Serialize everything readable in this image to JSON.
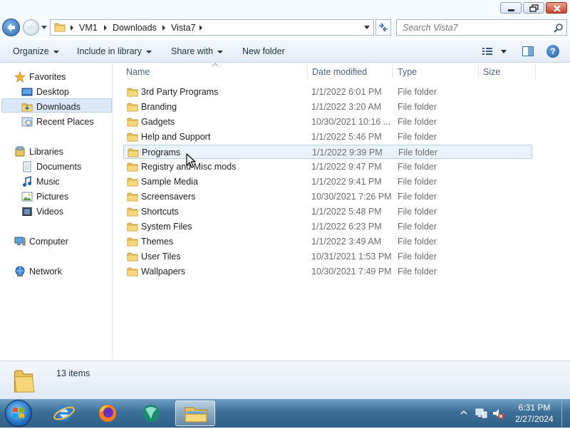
{
  "window": {
    "breadcrumb": [
      "VM1",
      "Downloads",
      "Vista7"
    ],
    "search_placeholder": "Search Vista7"
  },
  "toolbar": {
    "organize": "Organize",
    "include_in_library": "Include in library",
    "share_with": "Share with",
    "new_folder": "New folder"
  },
  "nav": {
    "favorites": "Favorites",
    "desktop": "Desktop",
    "downloads": "Downloads",
    "recent_places": "Recent Places",
    "libraries": "Libraries",
    "documents": "Documents",
    "music": "Music",
    "pictures": "Pictures",
    "videos": "Videos",
    "computer": "Computer",
    "network": "Network"
  },
  "columns": {
    "name": "Name",
    "date_modified": "Date modified",
    "type": "Type",
    "size": "Size"
  },
  "files": [
    {
      "name": "3rd Party Programs",
      "date": "1/1/2022 6:01 PM",
      "type": "File folder"
    },
    {
      "name": "Branding",
      "date": "1/1/2022 3:20 AM",
      "type": "File folder"
    },
    {
      "name": "Gadgets",
      "date": "10/30/2021 10:16 ...",
      "type": "File folder"
    },
    {
      "name": "Help and Support",
      "date": "1/1/2022 5:46 PM",
      "type": "File folder"
    },
    {
      "name": "Programs",
      "date": "1/1/2022 9:39 PM",
      "type": "File folder"
    },
    {
      "name": "Registry and Misc mods",
      "date": "1/1/2022 9:47 PM",
      "type": "File folder"
    },
    {
      "name": "Sample Media",
      "date": "1/1/2022 9:41 PM",
      "type": "File folder"
    },
    {
      "name": "Screensavers",
      "date": "10/30/2021 7:26 PM",
      "type": "File folder"
    },
    {
      "name": "Shortcuts",
      "date": "1/1/2022 5:48 PM",
      "type": "File folder"
    },
    {
      "name": "System Files",
      "date": "1/1/2022 6:23 PM",
      "type": "File folder"
    },
    {
      "name": "Themes",
      "date": "1/1/2022 3:49 AM",
      "type": "File folder"
    },
    {
      "name": "User Tiles",
      "date": "10/31/2021 1:53 PM",
      "type": "File folder"
    },
    {
      "name": "Wallpapers",
      "date": "10/30/2021 7:49 PM",
      "type": "File folder"
    }
  ],
  "status": {
    "item_count": "13 items"
  },
  "taskbar": {
    "time": "6:31 PM",
    "date": "2/27/2024"
  },
  "colors": {
    "accent": "#3c6f98",
    "selection": "#dbe8f7",
    "folder": "#e8c15a"
  }
}
